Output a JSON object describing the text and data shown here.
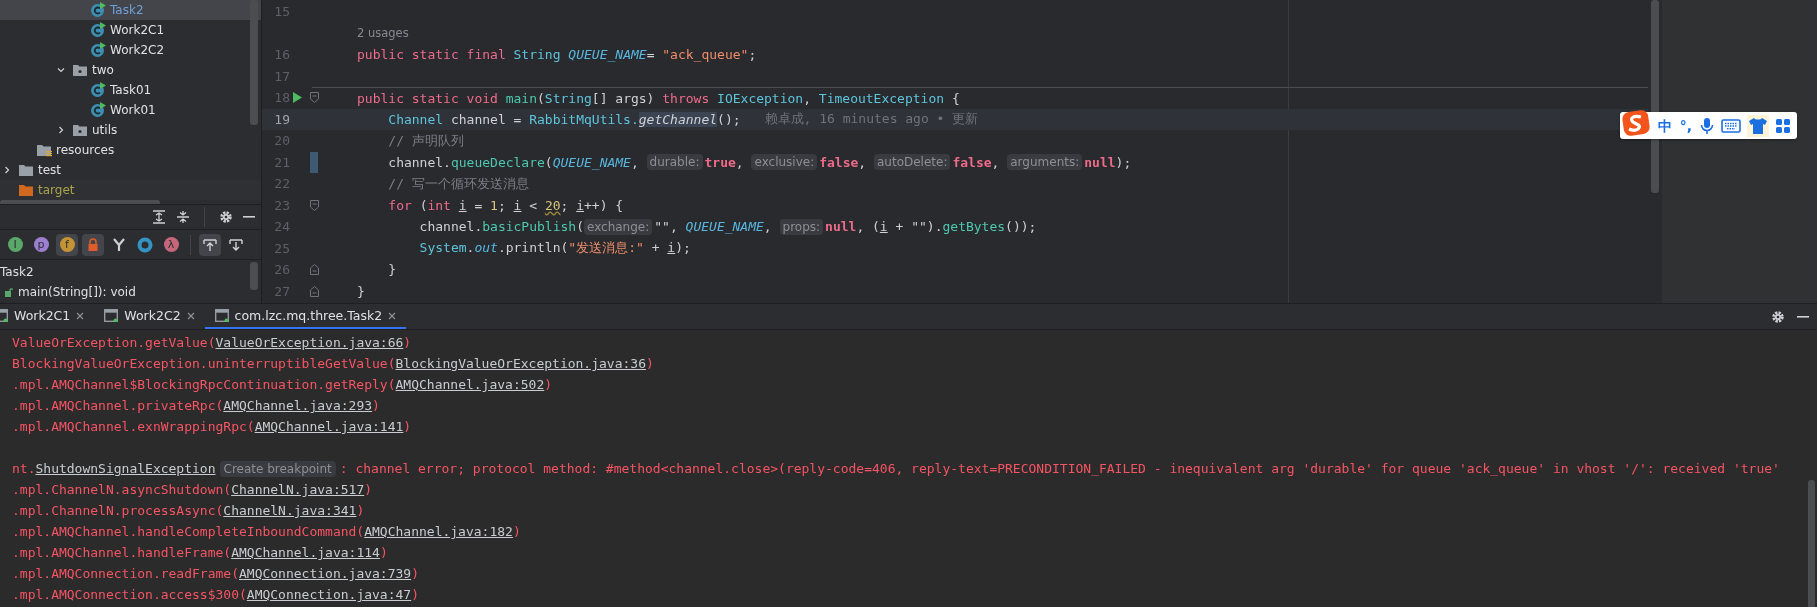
{
  "project_tree": [
    {
      "children": [
        {
          "children": [
            {
              "children": [
                {
                  "children": [
                    {
                      "label": "Task2",
                      "kind": "class",
                      "selected": true,
                      "modified": true
                    },
                    {
                      "label": "Work2C1",
                      "kind": "class",
                      "selected": false,
                      "modified": false
                    },
                    {
                      "label": "Work2C2",
                      "kind": "class",
                      "selected": false,
                      "modified": false
                    }
                  ]
                },
                {
                  "label": "two",
                  "kind": "package",
                  "expanded": true,
                  "selected": false,
                  "modified": false,
                  "children": [
                    {
                      "label": "Task01",
                      "kind": "class",
                      "selected": false,
                      "modified": false
                    },
                    {
                      "label": "Work01",
                      "kind": "class",
                      "selected": false,
                      "modified": false
                    }
                  ]
                },
                {
                  "label": "utils",
                  "kind": "package",
                  "expanded": false,
                  "selected": false,
                  "modified": false
                }
              ]
            }
          ]
        },
        {
          "label": "resources",
          "kind": "resources",
          "selected": false,
          "modified": false
        }
      ]
    },
    {
      "label": "test",
      "kind": "folder",
      "expanded": false,
      "selected": false,
      "modified": false
    },
    {
      "label": "target",
      "kind": "excluded",
      "selected": false,
      "modified": false
    }
  ],
  "structure_filters": [
    {
      "kind": "letter",
      "glyph": "I",
      "color": "#59a869",
      "selected": false
    },
    {
      "kind": "letter",
      "glyph": "p",
      "color": "#9c7fd1",
      "selected": false
    },
    {
      "kind": "letter",
      "glyph": "f",
      "color": "#c39336",
      "selected": true
    },
    {
      "kind": "lock",
      "color": "#e05c2b",
      "selected": true
    },
    {
      "kind": "fork",
      "color": "#ced0d6",
      "selected": false
    },
    {
      "kind": "ring",
      "color": "#3592c4",
      "selected": false
    },
    {
      "kind": "letter",
      "glyph": "λ",
      "color": "#c4677a",
      "selected": false
    }
  ],
  "autoscroll": [
    {
      "kind": "scroll_from",
      "selected": true
    },
    {
      "kind": "scroll_to",
      "selected": false
    }
  ],
  "structure": [
    {
      "label": "Task2",
      "children": [
        {
          "label": "main(String[]): void"
        }
      ]
    }
  ],
  "editor": {
    "lines": [
      {
        "kind": "code",
        "number": "15"
      },
      {
        "kind": "usages",
        "text": "2 usages"
      },
      {
        "kind": "code",
        "number": "16",
        "tokens": [
          {
            "kind": "kw",
            "text": "public static final "
          },
          {
            "kind": "type",
            "text": "String "
          },
          {
            "kind": "const",
            "text": "QUEUE_NAME"
          },
          {
            "kind": "plain",
            "text": "= "
          },
          {
            "kind": "str",
            "text": "\"ack_queue\""
          },
          {
            "kind": "plain",
            "text": ";"
          }
        ]
      },
      {
        "kind": "code",
        "number": "17"
      },
      {
        "kind": "code",
        "number": "18",
        "run": true,
        "fold_start": true,
        "separator_above": true,
        "tokens": [
          {
            "kind": "kw",
            "text": "public static void "
          },
          {
            "kind": "fn",
            "text": "main"
          },
          {
            "kind": "plain",
            "text": "("
          },
          {
            "kind": "type",
            "text": "String"
          },
          {
            "kind": "plain",
            "text": "[] args) "
          },
          {
            "kind": "kw",
            "text": "throws "
          },
          {
            "kind": "type",
            "text": "IOException"
          },
          {
            "kind": "plain",
            "text": ", "
          },
          {
            "kind": "type",
            "text": "TimeoutException"
          },
          {
            "kind": "plain",
            "text": " {"
          }
        ]
      },
      {
        "kind": "code",
        "number": "19",
        "current": true,
        "tokens": [
          {
            "kind": "type",
            "text": "    Channel "
          },
          {
            "kind": "plain",
            "text": "channel = "
          },
          {
            "kind": "type",
            "text": "RabbitMqUtils."
          },
          {
            "kind": "static_call",
            "text": "getChannel"
          },
          {
            "kind": "plain",
            "text": "();"
          },
          {
            "kind": "blame",
            "text": "赖卓成, 16 minutes ago • 更新"
          }
        ]
      },
      {
        "kind": "code",
        "number": "20",
        "tokens": [
          {
            "kind": "comment",
            "text": "    // 声明队列"
          }
        ]
      },
      {
        "kind": "code",
        "number": "21",
        "vcs_changed": true,
        "tokens": [
          {
            "kind": "plain",
            "text": "    channel."
          },
          {
            "kind": "fn",
            "text": "queueDeclare"
          },
          {
            "kind": "plain",
            "text": "("
          },
          {
            "kind": "const",
            "text": "QUEUE_NAME"
          },
          {
            "kind": "plain",
            "text": ", "
          },
          {
            "kind": "hint",
            "text": "durable:"
          },
          {
            "kind": "lit",
            "text": "true"
          },
          {
            "kind": "plain",
            "text": ", "
          },
          {
            "kind": "hint",
            "text": "exclusive:"
          },
          {
            "kind": "lit",
            "text": "false"
          },
          {
            "kind": "plain",
            "text": ", "
          },
          {
            "kind": "hint",
            "text": "autoDelete:"
          },
          {
            "kind": "lit",
            "text": "false"
          },
          {
            "kind": "plain",
            "text": ", "
          },
          {
            "kind": "hint",
            "text": "arguments:"
          },
          {
            "kind": "lit",
            "text": "null"
          },
          {
            "kind": "plain",
            "text": ");"
          }
        ]
      },
      {
        "kind": "code",
        "number": "22",
        "tokens": [
          {
            "kind": "comment",
            "text": "    // 写一个循环发送消息"
          }
        ]
      },
      {
        "kind": "code",
        "number": "23",
        "fold_start": true,
        "tokens": [
          {
            "kind": "kw",
            "text": "    for "
          },
          {
            "kind": "plain",
            "text": "("
          },
          {
            "kind": "kw",
            "text": "int "
          },
          {
            "kind": "local",
            "text": "i"
          },
          {
            "kind": "plain",
            "text": " = "
          },
          {
            "kind": "num",
            "text": "1"
          },
          {
            "kind": "plain",
            "text": "; "
          },
          {
            "kind": "local",
            "text": "i"
          },
          {
            "kind": "plain",
            "text": " < "
          },
          {
            "kind": "num_warn",
            "text": "20"
          },
          {
            "kind": "plain",
            "text": "; "
          },
          {
            "kind": "local",
            "text": "i"
          },
          {
            "kind": "plain",
            "text": "++) {"
          }
        ]
      },
      {
        "kind": "code",
        "number": "24",
        "tokens": [
          {
            "kind": "plain",
            "text": "        channel."
          },
          {
            "kind": "fn",
            "text": "basicPublish"
          },
          {
            "kind": "plain",
            "text": "("
          },
          {
            "kind": "hint",
            "text": "exchange:"
          },
          {
            "kind": "plain",
            "text": "\"\", "
          },
          {
            "kind": "const",
            "text": "QUEUE_NAME"
          },
          {
            "kind": "plain",
            "text": ", "
          },
          {
            "kind": "hint",
            "text": "props:"
          },
          {
            "kind": "lit",
            "text": "null"
          },
          {
            "kind": "plain",
            "text": ", ("
          },
          {
            "kind": "local",
            "text": "i"
          },
          {
            "kind": "plain",
            "text": " + \"\")."
          },
          {
            "kind": "fn",
            "text": "getBytes"
          },
          {
            "kind": "plain",
            "text": "());"
          }
        ]
      },
      {
        "kind": "code",
        "number": "25",
        "tokens": [
          {
            "kind": "type",
            "text": "        System"
          },
          {
            "kind": "plain",
            "text": "."
          },
          {
            "kind": "field",
            "text": "out"
          },
          {
            "kind": "plain",
            "text": ".println("
          },
          {
            "kind": "str",
            "text": "\"发送消息:\""
          },
          {
            "kind": "plain",
            "text": " + "
          },
          {
            "kind": "local",
            "text": "i"
          },
          {
            "kind": "plain",
            "text": ");"
          }
        ]
      },
      {
        "kind": "code",
        "number": "26",
        "fold_end": true,
        "tokens": [
          {
            "kind": "plain",
            "text": "    }"
          }
        ]
      },
      {
        "kind": "code",
        "number": "27",
        "fold_end": true,
        "tokens": [
          {
            "kind": "plain",
            "text": "}"
          }
        ]
      }
    ]
  },
  "ime_toolbar": [
    {
      "kind": "logo",
      "selected": false
    },
    {
      "kind": "text",
      "text": "中",
      "selected": false
    },
    {
      "kind": "text",
      "text": "°,",
      "selected": false
    },
    {
      "kind": "mic",
      "selected": false
    },
    {
      "kind": "keyboard",
      "selected": false
    },
    {
      "kind": "skin",
      "selected": true
    },
    {
      "kind": "toolbox",
      "selected": false
    }
  ],
  "console": {
    "tabs": [
      {
        "label": "Work2C1",
        "selected": false
      },
      {
        "label": "Work2C2",
        "selected": false
      },
      {
        "label": "com.lzc.mq.three.Task2",
        "selected": true
      }
    ],
    "lines": [
      {
        "kind": "trace",
        "prefix": "ValueOrException.getValue(",
        "link": "ValueOrException.java:66",
        "suffix": ")"
      },
      {
        "kind": "trace",
        "prefix": "BlockingValueOrException.uninterruptibleGetValue(",
        "link": "BlockingValueOrException.java:36",
        "suffix": ")"
      },
      {
        "kind": "trace",
        "prefix": ".mpl.AMQChannel$BlockingRpcContinuation.getReply(",
        "link": "AMQChannel.java:502",
        "suffix": ")"
      },
      {
        "kind": "trace",
        "prefix": ".mpl.AMQChannel.privateRpc(",
        "link": "AMQChannel.java:293",
        "suffix": ")"
      },
      {
        "kind": "trace",
        "prefix": ".mpl.AMQChannel.exnWrappingRpc(",
        "link": "AMQChannel.java:141",
        "suffix": ")"
      },
      {
        "kind": "blank"
      },
      {
        "kind": "trace",
        "prefix": "nt.",
        "link": "ShutdownSignalException",
        "hint": "Create breakpoint",
        "suffix": ": channel error; protocol method: #method<channel.close>(reply-code=406, reply-text=PRECONDITION_FAILED - inequivalent arg 'durable' for queue 'ack_queue' in vhost '/': received 'true'"
      },
      {
        "kind": "trace",
        "prefix": ".mpl.ChannelN.asyncShutdown(",
        "link": "ChannelN.java:517",
        "suffix": ")"
      },
      {
        "kind": "trace",
        "prefix": ".mpl.ChannelN.processAsync(",
        "link": "ChannelN.java:341",
        "suffix": ")"
      },
      {
        "kind": "trace",
        "prefix": ".mpl.AMQChannel.handleCompleteInboundCommand(",
        "link": "AMQChannel.java:182",
        "suffix": ")"
      },
      {
        "kind": "trace",
        "prefix": ".mpl.AMQChannel.handleFrame(",
        "link": "AMQChannel.java:114",
        "suffix": ")"
      },
      {
        "kind": "trace",
        "prefix": ".mpl.AMQConnection.readFrame(",
        "link": "AMQConnection.java:739",
        "suffix": ")"
      },
      {
        "kind": "trace",
        "prefix": ".mpl.AMQConnection.access$300(",
        "link": "AMQConnection.java:47",
        "suffix": ")"
      }
    ]
  }
}
